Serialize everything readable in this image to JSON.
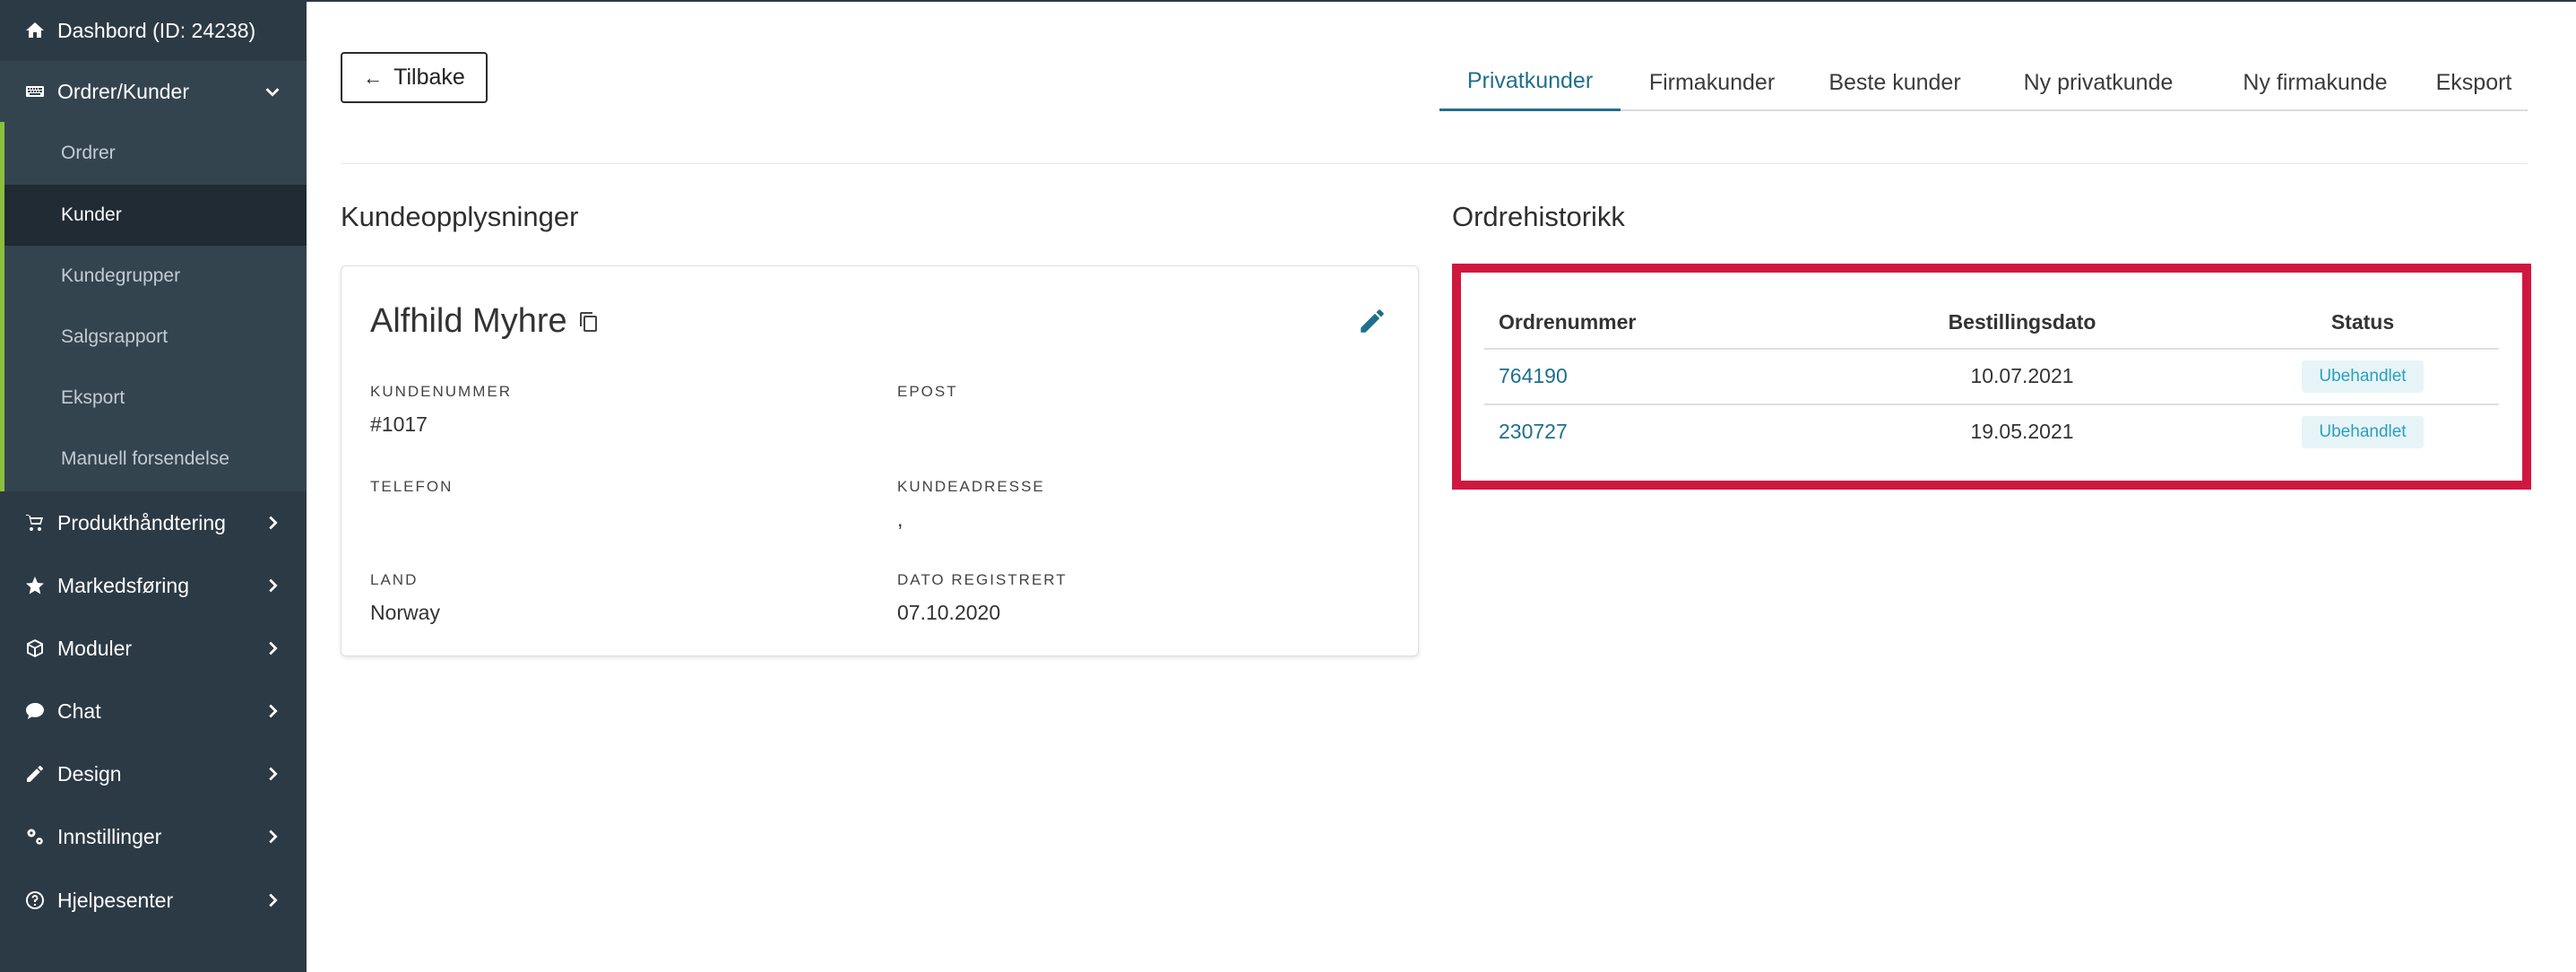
{
  "sidebar": {
    "dashboard": {
      "label": "Dashbord (ID: 24238)",
      "icon": "home-icon"
    },
    "orders_customers": {
      "label": "Ordrer/Kunder",
      "icon": "keyboard-icon"
    },
    "submenu": [
      "Ordrer",
      "Kunder",
      "Kundegrupper",
      "Salgsrapport",
      "Eksport",
      "Manuell forsendelse"
    ],
    "active_submenu": "Kunder",
    "groups": [
      {
        "label": "Produkthåndtering",
        "icon": "cart-icon"
      },
      {
        "label": "Markedsføring",
        "icon": "star-icon"
      },
      {
        "label": "Moduler",
        "icon": "cube-icon"
      },
      {
        "label": "Chat",
        "icon": "chat-icon"
      },
      {
        "label": "Design",
        "icon": "pencil-icon"
      },
      {
        "label": "Innstillinger",
        "icon": "gears-icon"
      },
      {
        "label": "Hjelpesenter",
        "icon": "help-circle-icon"
      }
    ]
  },
  "header": {
    "back_label": "Tilbake",
    "tabs": [
      "Privatkunder",
      "Firmakunder",
      "Beste kunder",
      "Ny privatkunde",
      "Ny firmakunde",
      "Eksport"
    ],
    "active_tab": "Privatkunder"
  },
  "customer": {
    "section_title": "Kundeopplysninger",
    "name": "Alfhild Myhre",
    "customer_number_label": "KUNDENUMMER",
    "customer_number": "#1017",
    "email_label": "EPOST",
    "email": "",
    "phone_label": "TELEFON",
    "phone": "",
    "address_label": "KUNDEADRESSE",
    "address": ",",
    "country_label": "LAND",
    "country": "Norway",
    "registered_label": "DATO REGISTRERT",
    "registered": "07.10.2020"
  },
  "orders": {
    "section_title": "Ordrehistorikk",
    "columns": [
      "Ordrenummer",
      "Bestillingsdato",
      "Status"
    ],
    "rows": [
      {
        "number": "764190",
        "date": "10.07.2021",
        "status": "Ubehandlet"
      },
      {
        "number": "230727",
        "date": "19.05.2021",
        "status": "Ubehandlet"
      }
    ]
  },
  "colors": {
    "sidebar_bg": "#2c3a45",
    "accent": "#236f8b",
    "highlight_border": "#d0183f",
    "submenu_marker": "#8bbf3f"
  }
}
